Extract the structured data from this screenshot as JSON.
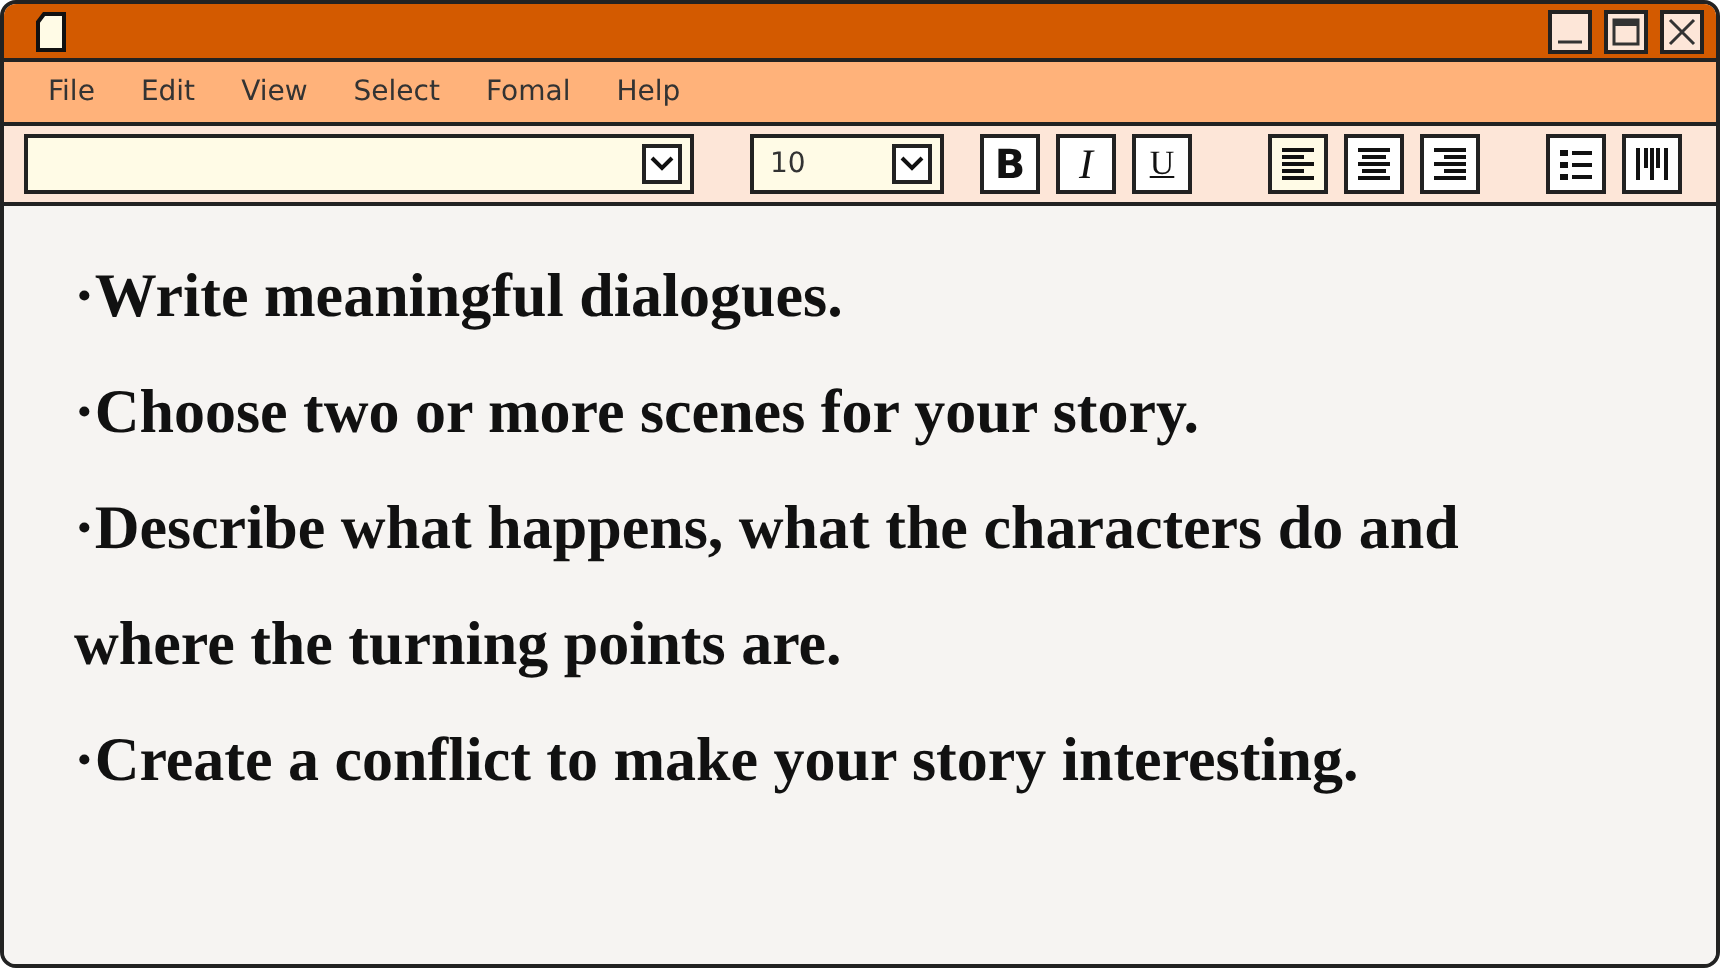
{
  "menu": [
    "File",
    "Edit",
    "View",
    "Select",
    "Fomal",
    "Help"
  ],
  "toolbar": {
    "size_field": {
      "value": "10"
    },
    "format_buttons": [
      {
        "kind": "bold",
        "label": "B"
      },
      {
        "kind": "italic",
        "label": "I"
      },
      {
        "kind": "underline",
        "label": "U"
      }
    ],
    "align_buttons": [
      {
        "kind": "left",
        "selected": true
      },
      {
        "kind": "center",
        "selected": false
      },
      {
        "kind": "right",
        "selected": false
      }
    ]
  },
  "paragraphs": [
    "·Write meaningful dialogues.",
    "·Choose two or more scenes for your story.",
    "·Describe what happens, what the characters do and where the turning points are.",
    "·Create a conflict to make your story interesting."
  ]
}
